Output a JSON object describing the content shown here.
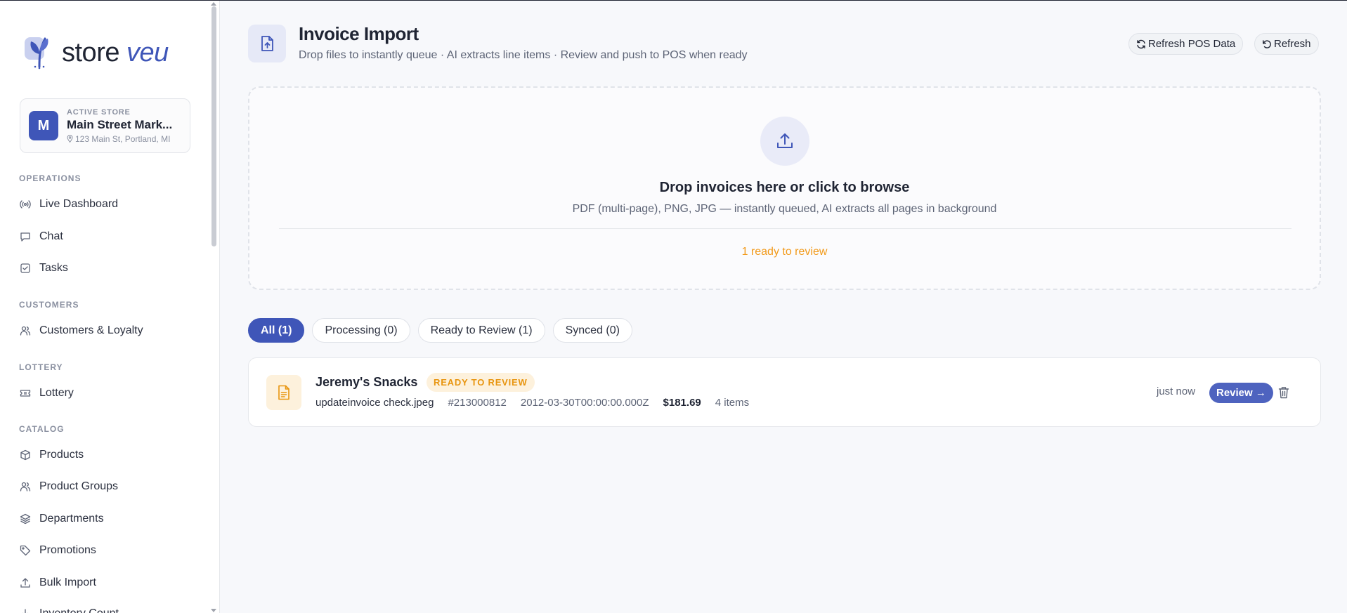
{
  "brand": {
    "name_main": "store",
    "name_accent": "veu",
    "accent_color": "#3f56b8"
  },
  "store": {
    "label": "ACTIVE STORE",
    "initial": "M",
    "name": "Main Street Mark...",
    "address": "123 Main St, Portland, MI"
  },
  "sidebar": {
    "sections": [
      {
        "label": "OPERATIONS",
        "items": [
          {
            "label": "Live Dashboard",
            "icon": "broadcast-icon"
          },
          {
            "label": "Chat",
            "icon": "chat-icon"
          },
          {
            "label": "Tasks",
            "icon": "checkbox-icon"
          }
        ]
      },
      {
        "label": "CUSTOMERS",
        "items": [
          {
            "label": "Customers & Loyalty",
            "icon": "users-icon"
          }
        ]
      },
      {
        "label": "LOTTERY",
        "items": [
          {
            "label": "Lottery",
            "icon": "ticket-icon"
          }
        ]
      },
      {
        "label": "CATALOG",
        "items": [
          {
            "label": "Products",
            "icon": "box-icon"
          },
          {
            "label": "Product Groups",
            "icon": "users-icon"
          },
          {
            "label": "Departments",
            "icon": "layers-icon"
          },
          {
            "label": "Promotions",
            "icon": "tag-icon"
          },
          {
            "label": "Bulk Import",
            "icon": "upload-icon"
          },
          {
            "label": "Inventory Count",
            "icon": "download-icon"
          }
        ]
      }
    ]
  },
  "header": {
    "title": "Invoice Import",
    "subtitle": "Drop files to instantly queue · AI extracts line items · Review and push to POS when ready",
    "refresh_pos_label": "Refresh POS Data",
    "refresh_label": "Refresh"
  },
  "dropzone": {
    "title": "Drop invoices here or click to browse",
    "subtitle": "PDF (multi-page), PNG, JPG — instantly queued, AI extracts all pages in background",
    "status": "1 ready to review"
  },
  "tabs": [
    {
      "label": "All (1)",
      "active": true
    },
    {
      "label": "Processing (0)",
      "active": false
    },
    {
      "label": "Ready to Review (1)",
      "active": false
    },
    {
      "label": "Synced (0)",
      "active": false
    }
  ],
  "invoices": [
    {
      "vendor": "Jeremy's Snacks",
      "status": "READY TO REVIEW",
      "file": "updateinvoice check.jpeg",
      "number": "#213000812",
      "date": "2012-03-30T00:00:00.000Z",
      "total": "$181.69",
      "items": "4 items",
      "time": "just now",
      "review_label": "Review →"
    }
  ]
}
